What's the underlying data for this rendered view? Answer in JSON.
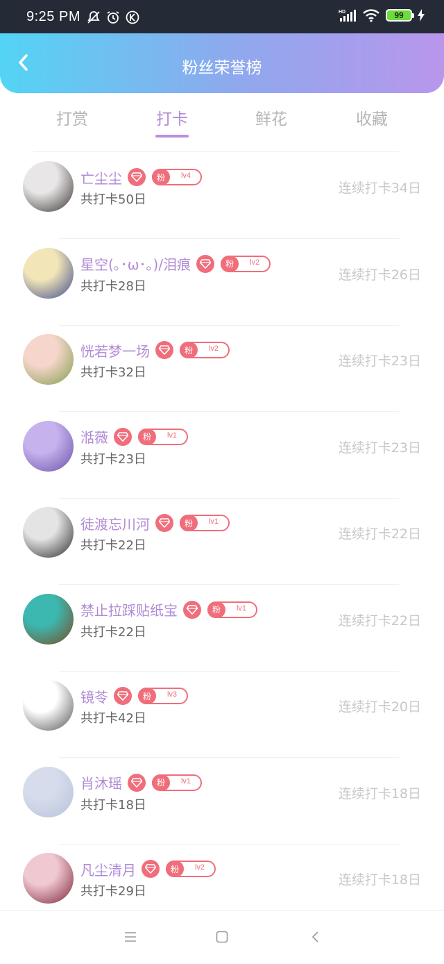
{
  "status": {
    "time": "9:25 PM",
    "battery": "99",
    "network": "HD"
  },
  "header": {
    "title": "粉丝荣誉榜"
  },
  "tabs": [
    {
      "label": "打赏",
      "active": false
    },
    {
      "label": "打卡",
      "active": true
    },
    {
      "label": "鲜花",
      "active": false
    },
    {
      "label": "收藏",
      "active": false
    }
  ],
  "fan_badge_label": "粉",
  "users": [
    {
      "name": "亡尘尘",
      "level": "lv4",
      "total": "共打卡50日",
      "streak": "连续打卡34日",
      "avatar_colors": [
        "#e8e6e6",
        "#3a3433"
      ]
    },
    {
      "name": "星空(｡･ω･｡)/泪痕",
      "level": "lv2",
      "total": "共打卡28日",
      "streak": "连续打卡26日",
      "avatar_colors": [
        "#f2e6b8",
        "#3e4a8c"
      ]
    },
    {
      "name": "恍若梦一场",
      "level": "lv2",
      "total": "共打卡32日",
      "streak": "连续打卡23日",
      "avatar_colors": [
        "#f6d6cc",
        "#7f9c4a"
      ]
    },
    {
      "name": "湉薇",
      "level": "lv1",
      "total": "共打卡23日",
      "streak": "连续打卡23日",
      "avatar_colors": [
        "#c6b3ee",
        "#6a52a8"
      ]
    },
    {
      "name": "徒渡忘川河",
      "level": "lv1",
      "total": "共打卡22日",
      "streak": "连续打卡22日",
      "avatar_colors": [
        "#e4e4e4",
        "#2b2b2b"
      ]
    },
    {
      "name": "禁止拉踩贴纸宝",
      "level": "lv1",
      "total": "共打卡22日",
      "streak": "连续打卡22日",
      "avatar_colors": [
        "#3cb8b0",
        "#7a4a22"
      ]
    },
    {
      "name": "镜苓",
      "level": "lv3",
      "total": "共打卡42日",
      "streak": "连续打卡20日",
      "avatar_colors": [
        "#ffffff",
        "#555555"
      ]
    },
    {
      "name": "肖沐瑶",
      "level": "lv1",
      "total": "共打卡18日",
      "streak": "连续打卡18日",
      "avatar_colors": [
        "#d6dcec",
        "#b8c2da"
      ]
    },
    {
      "name": "凡尘清月",
      "level": "lv2",
      "total": "共打卡29日",
      "streak": "连续打卡18日",
      "avatar_colors": [
        "#f0c8d2",
        "#7c2436"
      ]
    }
  ]
}
